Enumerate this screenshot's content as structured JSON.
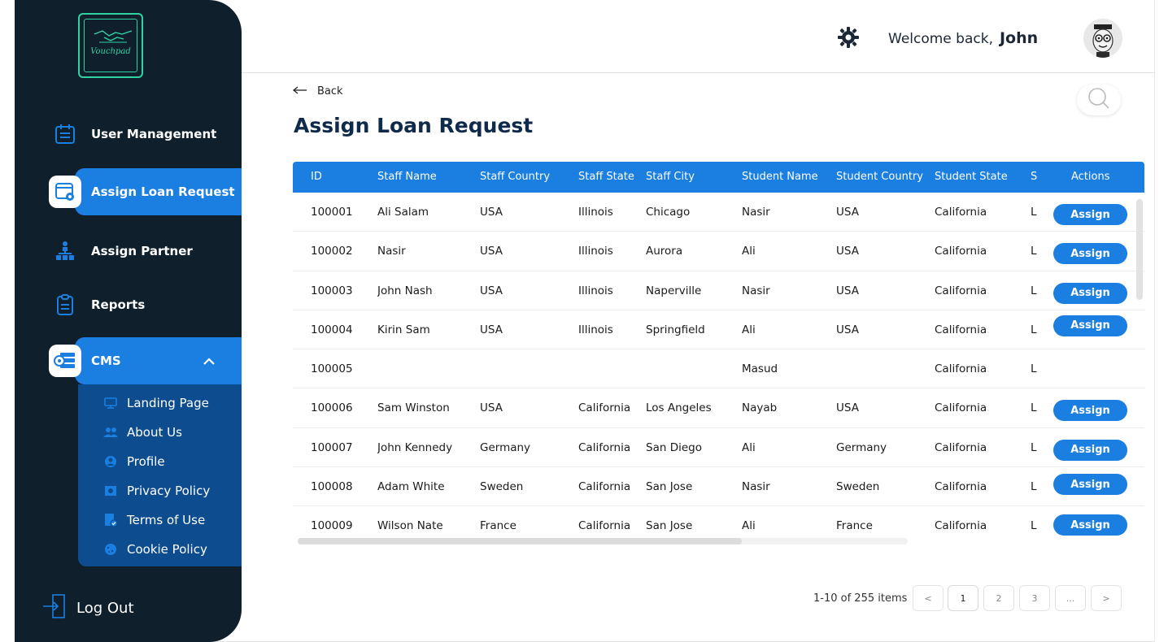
{
  "brand": {
    "logo_text": "Vouchpad",
    "accent": "#1a7fe0",
    "logo_color": "#2fd3a3"
  },
  "sidebar": {
    "items": [
      {
        "label": "User Management",
        "icon": "calendar-list-icon"
      },
      {
        "label": "Assign Loan Request",
        "icon": "browser-settings-icon",
        "active": true
      },
      {
        "label": "Assign Partner",
        "icon": "org-chart-icon"
      },
      {
        "label": "Reports",
        "icon": "clipboard-icon"
      },
      {
        "label": "CMS",
        "icon": "server-gear-icon",
        "expanded": true
      }
    ],
    "cms_sub": [
      {
        "label": "Landing Page",
        "icon": "monitor-icon"
      },
      {
        "label": "About Us",
        "icon": "users-icon"
      },
      {
        "label": "Profile",
        "icon": "user-circle-icon"
      },
      {
        "label": "Privacy Policy",
        "icon": "privacy-icon"
      },
      {
        "label": "Terms of Use",
        "icon": "document-check-icon"
      },
      {
        "label": "Cookie Policy",
        "icon": "cookie-icon"
      }
    ],
    "logout": "Log Out"
  },
  "header": {
    "welcome": "Welcome back,",
    "user": "John"
  },
  "main": {
    "back": "Back",
    "title": "Assign Loan Request",
    "columns": [
      "ID",
      "Staff Name",
      "Staff Country",
      "Staff State",
      "Staff City",
      "Student Name",
      "Student Country",
      "Student State",
      "S",
      "Actions"
    ],
    "rows": [
      {
        "id": "100001",
        "staff_name": "Ali Salam",
        "staff_country": "USA",
        "staff_state": "Illinois",
        "staff_city": "Chicago",
        "student_name": "Nasir",
        "student_country": "USA",
        "student_state": "California",
        "s": "Lo",
        "action": "Assign"
      },
      {
        "id": "100002",
        "staff_name": "Nasir",
        "staff_country": "USA",
        "staff_state": "Illinois",
        "staff_city": "Aurora",
        "student_name": "Ali",
        "student_country": "USA",
        "student_state": "California",
        "s": "Lo",
        "action": "Assign"
      },
      {
        "id": "100003",
        "staff_name": "John Nash",
        "staff_country": "USA",
        "staff_state": "Illinois",
        "staff_city": "Naperville",
        "student_name": "Nasir",
        "student_country": "USA",
        "student_state": "California",
        "s": "Lo",
        "action": "Assign"
      },
      {
        "id": "100004",
        "staff_name": "Kirin Sam",
        "staff_country": "USA",
        "staff_state": "Illinois",
        "staff_city": "Springfield",
        "student_name": "Ali",
        "student_country": "USA",
        "student_state": "California",
        "s": "Lo",
        "action": "Assign"
      },
      {
        "id": "100005",
        "staff_name": "",
        "staff_country": "",
        "staff_state": "",
        "staff_city": "",
        "student_name": "Masud",
        "student_country": "",
        "student_state": "California",
        "s": "Lo",
        "action": ""
      },
      {
        "id": "100006",
        "staff_name": "Sam Winston",
        "staff_country": "USA",
        "staff_state": "California",
        "staff_city": "Los Angeles",
        "student_name": "Nayab",
        "student_country": "USA",
        "student_state": "California",
        "s": "Lo",
        "action": "Assign"
      },
      {
        "id": "100007",
        "staff_name": "John Kennedy",
        "staff_country": "Germany",
        "staff_state": "California",
        "staff_city": "San Diego",
        "student_name": "Ali",
        "student_country": "Germany",
        "student_state": "California",
        "s": "Lo",
        "action": "Assign"
      },
      {
        "id": "100008",
        "staff_name": "Adam White",
        "staff_country": "Sweden",
        "staff_state": "California",
        "staff_city": "San Jose",
        "student_name": "Nasir",
        "student_country": "Sweden",
        "student_state": "California",
        "s": "Lo",
        "action": "Assign"
      },
      {
        "id": "100009",
        "staff_name": "Wilson Nate",
        "staff_country": "France",
        "staff_state": "California",
        "staff_city": "San Jose",
        "student_name": "Ali",
        "student_country": "France",
        "student_state": "California",
        "s": "Lo",
        "action": "Assign"
      }
    ]
  },
  "pagination": {
    "summary": "1-10 of 255 items",
    "prev": "<",
    "pages": [
      "1",
      "2",
      "3",
      "..."
    ],
    "next": ">"
  }
}
